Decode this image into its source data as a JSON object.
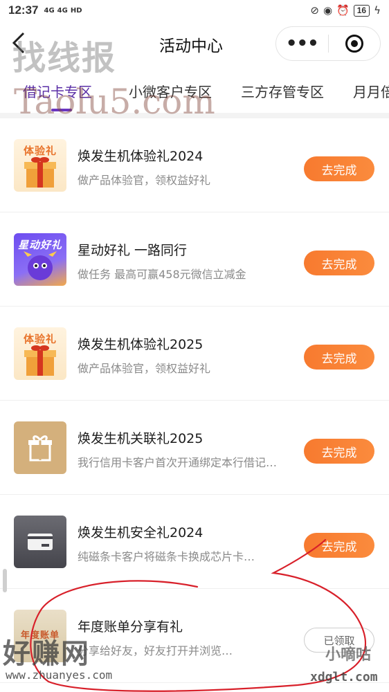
{
  "status_bar": {
    "time": "12:37",
    "network_1": "4G",
    "network_2": "4G",
    "hd": "HD",
    "battery": "16"
  },
  "nav": {
    "title": "活动中心",
    "more_glyph": "•••"
  },
  "tabs": [
    {
      "label": "借记卡专区",
      "active": true
    },
    {
      "label": "小微客户专区",
      "active": false
    },
    {
      "label": "三方存管专区",
      "active": false
    },
    {
      "label": "月月倍",
      "active": false
    }
  ],
  "items": [
    {
      "title": "焕发生机体验礼2024",
      "desc": "做产品体验官，领权益好礼",
      "button": "去完成",
      "thumb_text": "体验礼",
      "thumb": "gift-box"
    },
    {
      "title": "星动好礼 一路同行",
      "desc": "做任务 最高可赢458元微信立减金",
      "button": "去完成",
      "thumb_text": "星动好礼",
      "thumb": "star-mascot"
    },
    {
      "title": "焕发生机体验礼2025",
      "desc": "做产品体验官，领权益好礼",
      "button": "去完成",
      "thumb_text": "体验礼",
      "thumb": "gift-box"
    },
    {
      "title": "焕发生机关联礼2025",
      "desc": "我行信用卡客户首次开通绑定本行借记卡…",
      "button": "去完成",
      "thumb_text": "",
      "thumb": "gift-icon"
    },
    {
      "title": "焕发生机安全礼2024",
      "desc": "纯磁条卡客户将磁条卡换成芯片卡…",
      "button": "去完成",
      "thumb_text": "",
      "thumb": "card-icon"
    },
    {
      "title": "年度账单分享有礼",
      "desc": "分享给好友，好友打开并浏览…",
      "button": "已领取",
      "thumb_text": "年度账单",
      "thumb": "bill"
    }
  ],
  "watermarks": {
    "top_cn": "找线报",
    "top_en": "Taolu5.com",
    "bottom_cn": "好赚网",
    "bottom_url": "www.zhuanyes.com",
    "bottom_right_cn": "小嘀咕",
    "bottom_right_url": "xdglt.com"
  },
  "colors": {
    "accent_purple": "#6a35c0",
    "button_orange": "#f77a2f",
    "annotation_red": "#d8202a"
  }
}
